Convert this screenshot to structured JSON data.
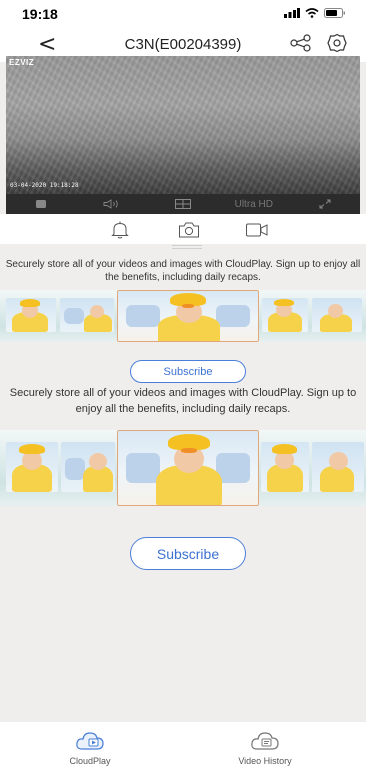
{
  "status_bar": {
    "time": "19:18"
  },
  "nav": {
    "title": "C3N(E00204399)",
    "back_glyph": "<"
  },
  "video": {
    "logo": "EZVIZ",
    "timestamp": "03-04-2020 19:18:28"
  },
  "controls": {
    "quality": "Ultra HD"
  },
  "promo": {
    "text": "Securely store all of your videos and images with CloudPlay. Sign up to enjoy all the benefits, including daily recaps.",
    "subscribe_label": "Subscribe"
  },
  "promo_large": {
    "text": "Securely store all of your videos and images with CloudPlay. Sign up to enjoy all the benefits, including daily recaps.",
    "subscribe_label": "Subscribe"
  },
  "tabs": [
    {
      "label": "CloudPlay",
      "icon": "cloud-play-icon"
    },
    {
      "label": "Video History",
      "icon": "video-history-icon"
    }
  ],
  "colors": {
    "accent": "#3d72d1",
    "frame": "#e0a77b",
    "controls_bg": "#2c2c2c",
    "page_bg": "#f0eeed"
  }
}
